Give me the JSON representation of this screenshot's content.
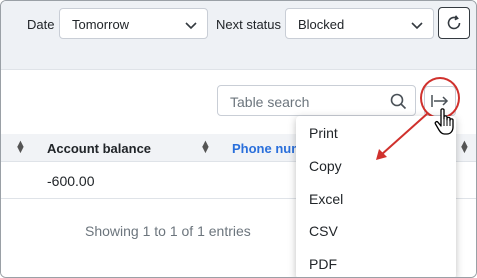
{
  "filters": {
    "date_label": "Date",
    "date_value": "Tomorrow",
    "status_label": "Next status",
    "status_value": "Blocked"
  },
  "table": {
    "search_placeholder": "Table search",
    "columns": [
      "Account balance",
      "Phone num"
    ],
    "rows": [
      [
        "-600.00",
        ""
      ]
    ],
    "info": "Showing 1 to 1 of 1 entries"
  },
  "export_menu": {
    "items": [
      "Print",
      "Copy",
      "Excel",
      "CSV",
      "PDF"
    ]
  },
  "colors": {
    "accent_link": "#2a6fdb",
    "annotation_red": "#d0312d"
  }
}
